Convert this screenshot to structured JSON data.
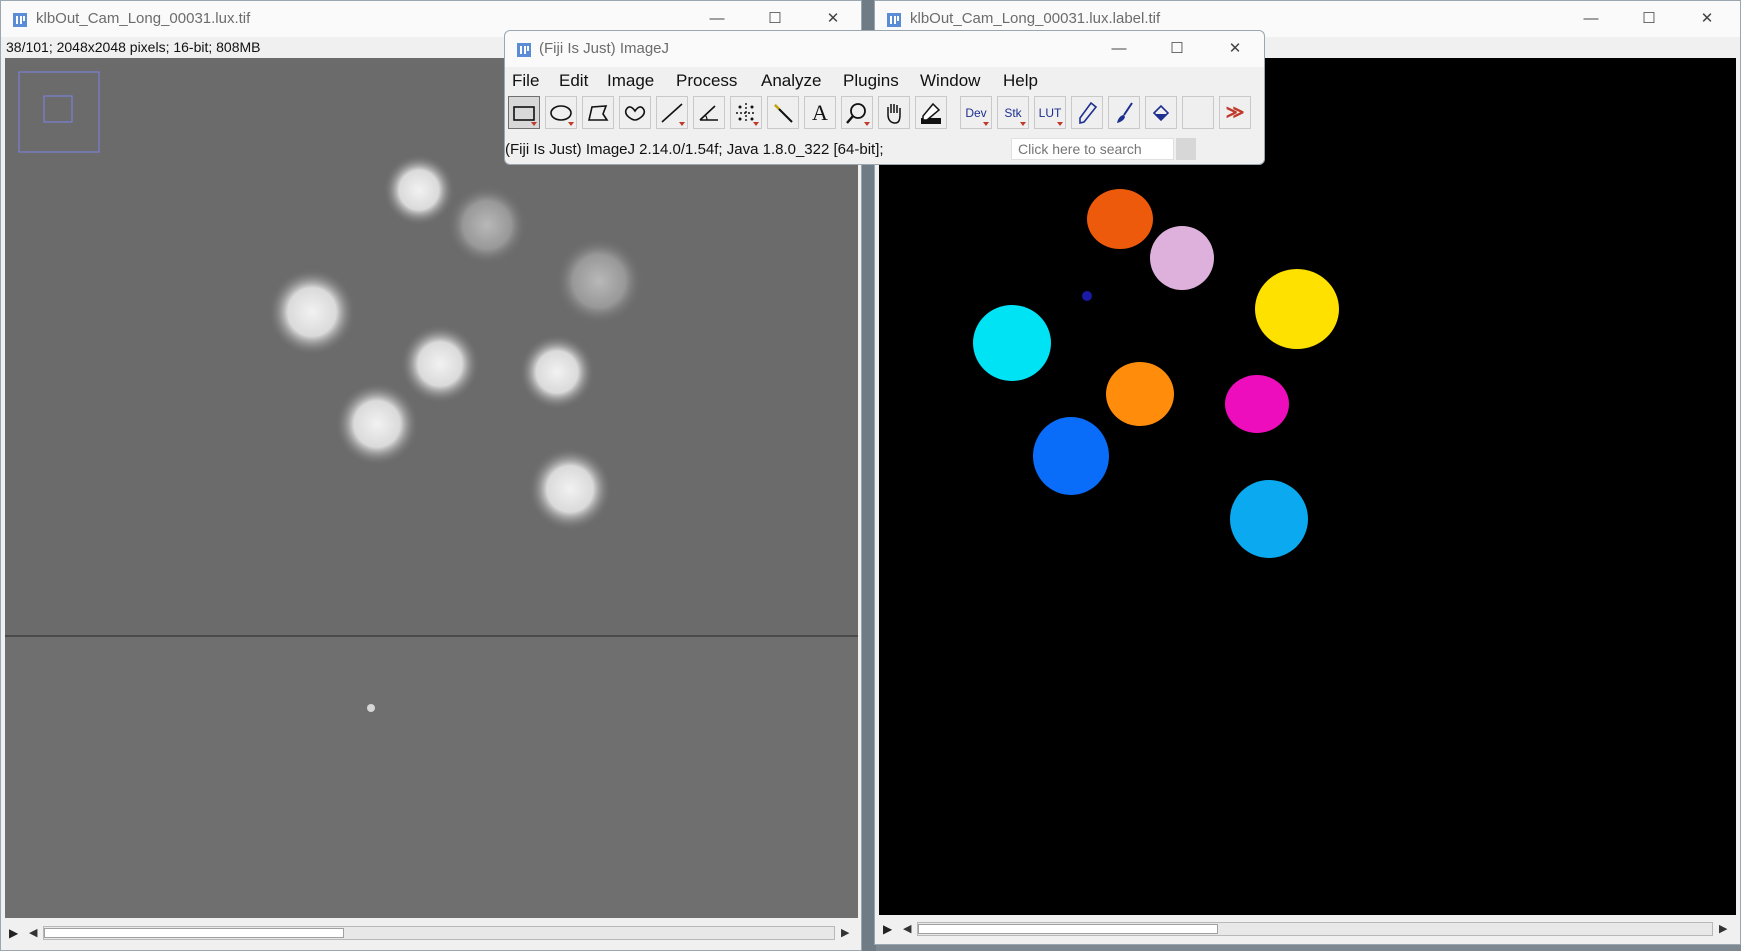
{
  "left_window": {
    "title": "klbOut_Cam_Long_00031.lux.tif",
    "info": "38/101; 2048x2048 pixels; 16-bit; 808MB",
    "minimize": "—",
    "maximize": "☐",
    "close": "✕",
    "play": "▶",
    "arrow_left": "◀",
    "arrow_right": "▶"
  },
  "right_window": {
    "title": "klbOut_Cam_Long_00031.lux.label.tif",
    "minimize": "—",
    "maximize": "☐",
    "close": "✕",
    "play": "▶",
    "arrow_left": "◀",
    "arrow_right": "▶",
    "label_colors": [
      "#ee5a0b",
      "#deb0dc",
      "#ffe100",
      "#00e3f5",
      "#ff8c0a",
      "#ee0dbc",
      "#0a6dfa",
      "#0ba9ef",
      "#1a1aa6"
    ]
  },
  "imagej": {
    "title": "(Fiji Is Just) ImageJ",
    "minimize": "—",
    "maximize": "☐",
    "close": "✕",
    "menu": [
      "File",
      "Edit",
      "Image",
      "Process",
      "Analyze",
      "Plugins",
      "Window",
      "Help"
    ],
    "tools": [
      {
        "name": "rectangle-tool-icon"
      },
      {
        "name": "oval-tool-icon"
      },
      {
        "name": "polygon-tool-icon"
      },
      {
        "name": "freehand-tool-icon"
      },
      {
        "name": "line-tool-icon"
      },
      {
        "name": "angle-tool-icon"
      },
      {
        "name": "point-tool-icon"
      },
      {
        "name": "wand-tool-icon"
      },
      {
        "name": "text-tool-icon",
        "label": "A"
      },
      {
        "name": "magnifier-tool-icon"
      },
      {
        "name": "hand-tool-icon"
      },
      {
        "name": "color-picker-tool-icon"
      },
      {
        "name": "dev-menu-icon",
        "label": "Dev"
      },
      {
        "name": "stacks-menu-icon",
        "label": "Stk"
      },
      {
        "name": "lut-menu-icon",
        "label": "LUT"
      },
      {
        "name": "pencil-tool-icon"
      },
      {
        "name": "brush-tool-icon"
      },
      {
        "name": "flood-fill-tool-icon"
      },
      {
        "name": "empty-tool-slot"
      },
      {
        "name": "more-tools-icon",
        "label": "≫"
      }
    ],
    "status": "(Fiji Is Just) ImageJ 2.14.0/1.54f; Java 1.8.0_322 [64-bit];",
    "search_placeholder": "Click here to search"
  }
}
